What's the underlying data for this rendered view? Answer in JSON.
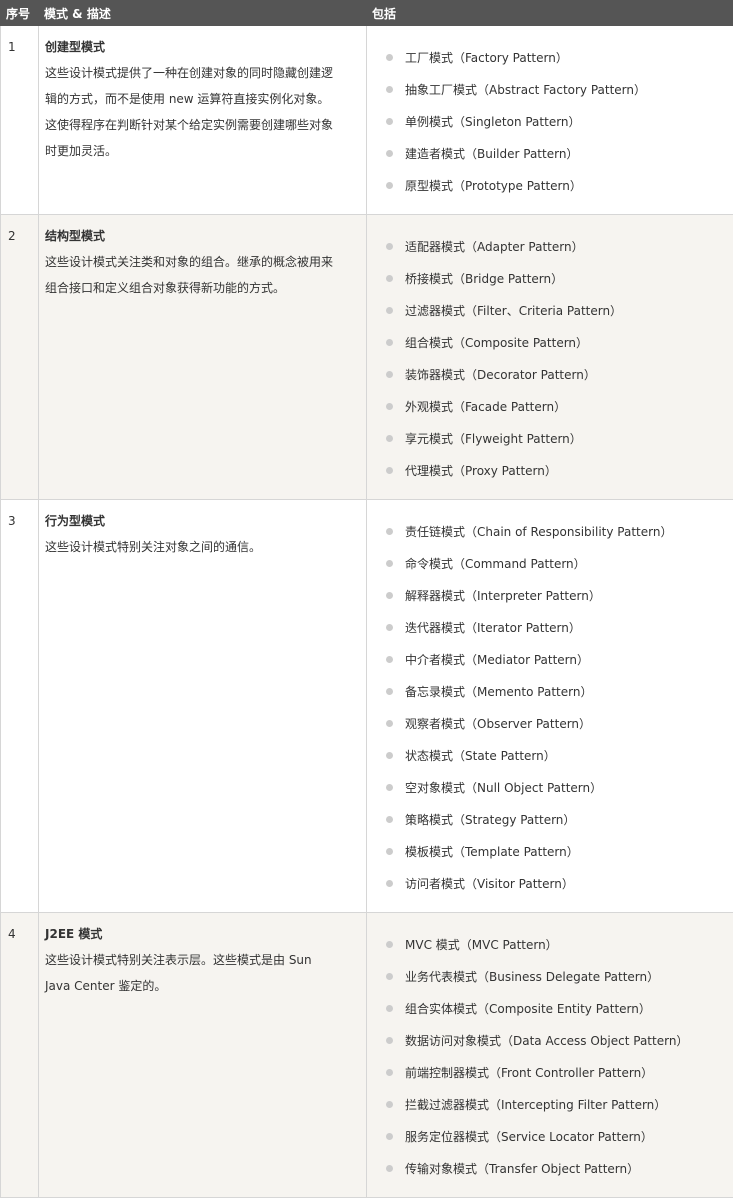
{
  "header": {
    "col_index": "序号",
    "col_mode": "模式 & 描述",
    "col_includes": "包括"
  },
  "colors": {
    "header_bg": "#555555",
    "header_text": "#ffffff",
    "row_alt_bg": "#f6f4f0",
    "border": "#d6d6d6",
    "bullet": "#cccccc"
  },
  "rows": [
    {
      "index": "1",
      "title": "创建型模式",
      "desc_lines": [
        "这些设计模式提供了一种在创建对象的同时隐藏创建逻",
        "辑的方式，而不是使用 new 运算符直接实例化对象。",
        "这使得程序在判断针对某个给定实例需要创建哪些对象",
        "时更加灵活。"
      ],
      "patterns": [
        "工厂模式（Factory Pattern）",
        "抽象工厂模式（Abstract Factory Pattern）",
        "单例模式（Singleton Pattern）",
        "建造者模式（Builder Pattern）",
        "原型模式（Prototype Pattern）"
      ]
    },
    {
      "index": "2",
      "title": "结构型模式",
      "desc_lines": [
        "这些设计模式关注类和对象的组合。继承的概念被用来",
        "组合接口和定义组合对象获得新功能的方式。"
      ],
      "patterns": [
        "适配器模式（Adapter Pattern）",
        "桥接模式（Bridge Pattern）",
        "过滤器模式（Filter、Criteria Pattern）",
        "组合模式（Composite Pattern）",
        "装饰器模式（Decorator Pattern）",
        "外观模式（Facade Pattern）",
        "享元模式（Flyweight Pattern）",
        "代理模式（Proxy Pattern）"
      ]
    },
    {
      "index": "3",
      "title": "行为型模式",
      "desc_lines": [
        "这些设计模式特别关注对象之间的通信。"
      ],
      "patterns": [
        "责任链模式（Chain of Responsibility Pattern）",
        "命令模式（Command Pattern）",
        "解释器模式（Interpreter Pattern）",
        "迭代器模式（Iterator Pattern）",
        "中介者模式（Mediator Pattern）",
        "备忘录模式（Memento Pattern）",
        "观察者模式（Observer Pattern）",
        "状态模式（State Pattern）",
        "空对象模式（Null Object Pattern）",
        "策略模式（Strategy Pattern）",
        "模板模式（Template Pattern）",
        "访问者模式（Visitor Pattern）"
      ]
    },
    {
      "index": "4",
      "title": "J2EE 模式",
      "desc_lines": [
        "这些设计模式特别关注表示层。这些模式是由 Sun",
        "Java Center 鉴定的。"
      ],
      "patterns": [
        "MVC 模式（MVC Pattern）",
        "业务代表模式（Business Delegate Pattern）",
        "组合实体模式（Composite Entity Pattern）",
        "数据访问对象模式（Data Access Object Pattern）",
        "前端控制器模式（Front Controller Pattern）",
        "拦截过滤器模式（Intercepting Filter Pattern）",
        "服务定位器模式（Service Locator Pattern）",
        "传输对象模式（Transfer Object Pattern）"
      ]
    }
  ]
}
